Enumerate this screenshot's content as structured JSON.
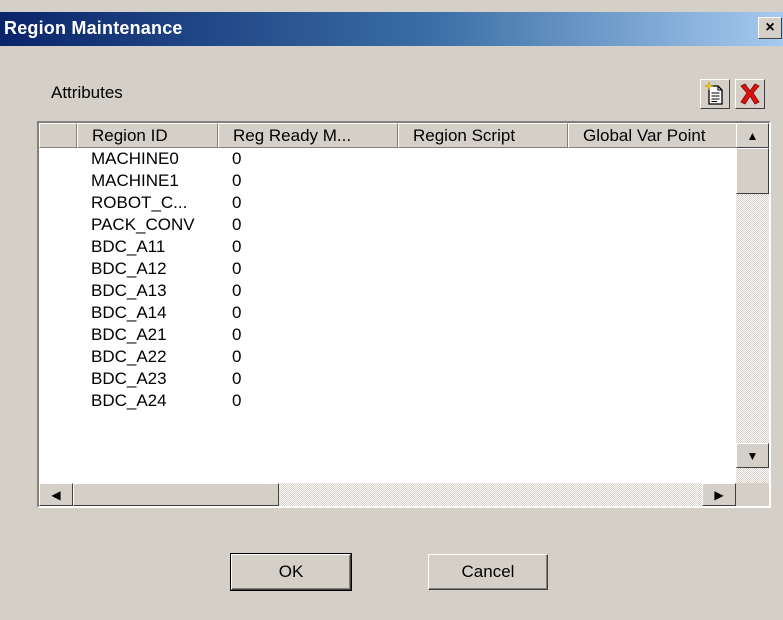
{
  "window": {
    "title": "Region Maintenance",
    "close_glyph": "×"
  },
  "group_label": "Attributes",
  "toolbar": {
    "new_icon": "new-document-icon",
    "delete_icon": "delete-x-icon"
  },
  "grid": {
    "columns": [
      "",
      "Region ID",
      "Reg Ready M...",
      "Region Script",
      "Global Var Point"
    ],
    "rows": [
      {
        "id": "MACHINE0",
        "ready": "0"
      },
      {
        "id": "MACHINE1",
        "ready": "0"
      },
      {
        "id": "ROBOT_C...",
        "ready": "0"
      },
      {
        "id": "PACK_CONV",
        "ready": "0"
      },
      {
        "id": "BDC_A11",
        "ready": "0"
      },
      {
        "id": "BDC_A12",
        "ready": "0"
      },
      {
        "id": "BDC_A13",
        "ready": "0"
      },
      {
        "id": "BDC_A14",
        "ready": "0"
      },
      {
        "id": "BDC_A21",
        "ready": "0"
      },
      {
        "id": "BDC_A22",
        "ready": "0"
      },
      {
        "id": "BDC_A23",
        "ready": "0"
      },
      {
        "id": "BDC_A24",
        "ready": "0"
      }
    ]
  },
  "buttons": {
    "ok": "OK",
    "cancel": "Cancel"
  },
  "colors": {
    "title_start": "#0a246a",
    "title_end": "#a6caf0",
    "face": "#d4d0c8"
  }
}
